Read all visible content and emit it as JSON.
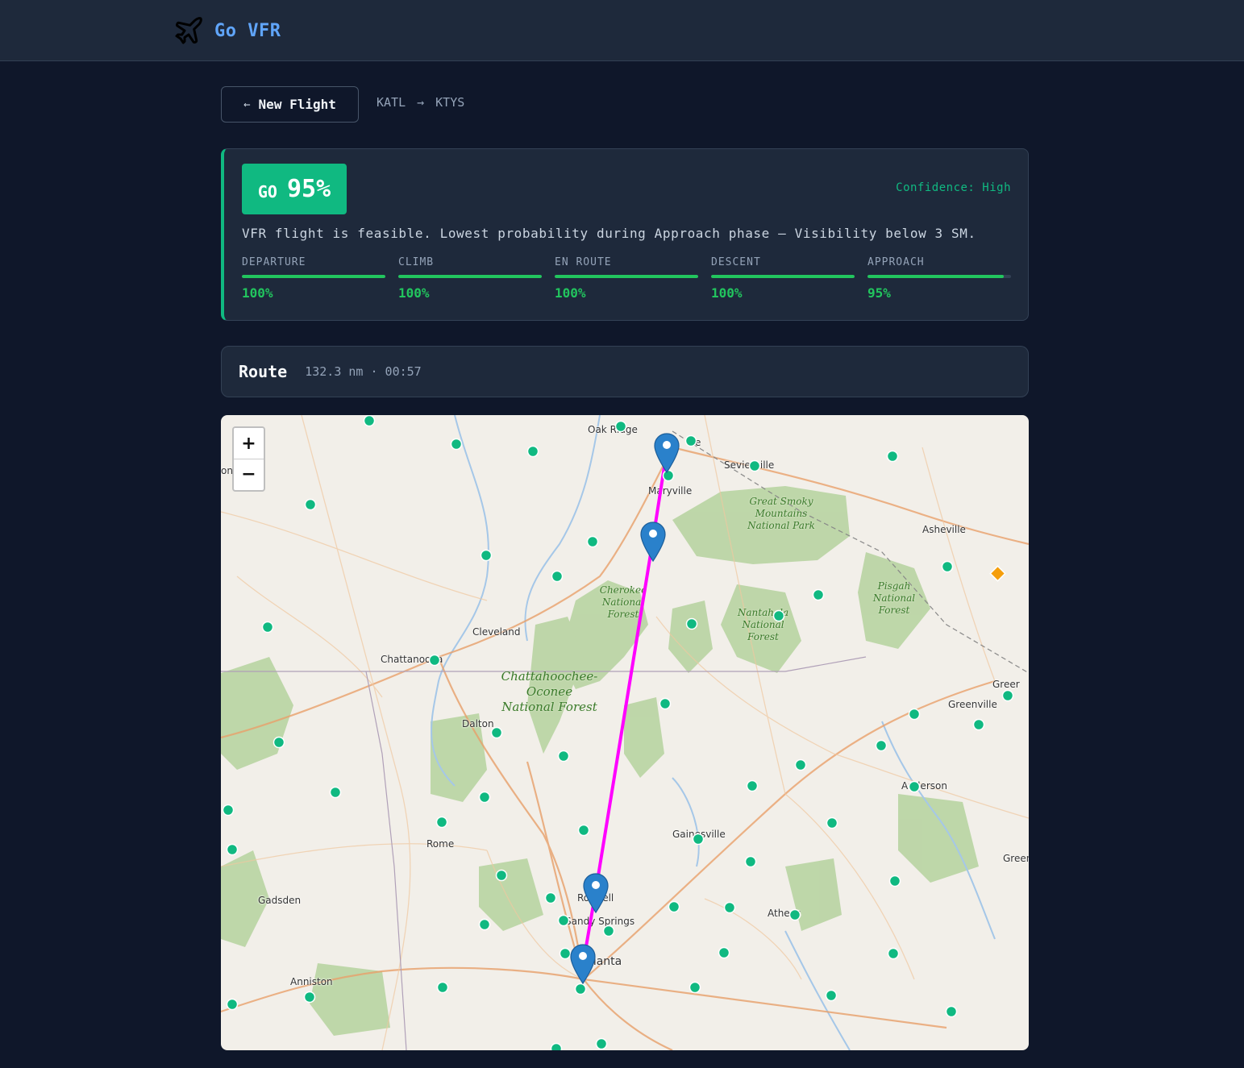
{
  "app": {
    "name": "Go VFR",
    "logo_icon": "airplane-icon"
  },
  "nav": {
    "back_label": "New Flight",
    "back_arrow": "←",
    "departure": "KATL",
    "arrow": "→",
    "destination": "KTYS"
  },
  "verdict": {
    "decision": "GO",
    "probability": "95%",
    "confidence": "Confidence: High",
    "summary": "VFR flight is feasible. Lowest probability during Approach phase — Visibility below 3 SM.",
    "phases": [
      {
        "name": "DEPARTURE",
        "value": "100%",
        "fraction": 1.0
      },
      {
        "name": "CLIMB",
        "value": "100%",
        "fraction": 1.0
      },
      {
        "name": "EN ROUTE",
        "value": "100%",
        "fraction": 1.0
      },
      {
        "name": "DESCENT",
        "value": "100%",
        "fraction": 1.0
      },
      {
        "name": "APPROACH",
        "value": "95%",
        "fraction": 0.95
      }
    ],
    "accent_color": "#10b981"
  },
  "route": {
    "title": "Route",
    "stats": "132.3 nm · 00:57",
    "line_color": "#ff00ff"
  },
  "map": {
    "zoom_in": "+",
    "zoom_out": "−",
    "cities": {
      "oak_ridge": "Oak Ridge",
      "knoxville": "e",
      "sevierville": "Sevierville",
      "maryville": "Maryville",
      "asheville": "Asheville",
      "cleveland": "Cleveland",
      "chattanooga": "Chattanooga",
      "dalton": "Dalton",
      "rome": "Rome",
      "gadsden": "Gadsden",
      "anniston": "Anniston",
      "roswell": "Roswell",
      "sandy_springs": "Sandy Springs",
      "atlanta": "Atlanta",
      "gainesville": "Gainesville",
      "athens": "Athens",
      "anderson": "Anderson",
      "greenville": "Greenville",
      "greer": "Greer",
      "greenwood": "Greenw",
      "west_edge": "on"
    },
    "parks": {
      "smoky": "Great Smoky Mountains National Park",
      "cherokee": "Cherokee National Forest",
      "nantahala": "Nantahala National Forest",
      "pisgah": "Pisgah National Forest",
      "chattahoochee": "Chattahoochee-Oconee National Forest"
    },
    "marker_color": "#2a81cb",
    "airport_dot_color": "#10b981",
    "hazard_color": "#f59e0b"
  }
}
